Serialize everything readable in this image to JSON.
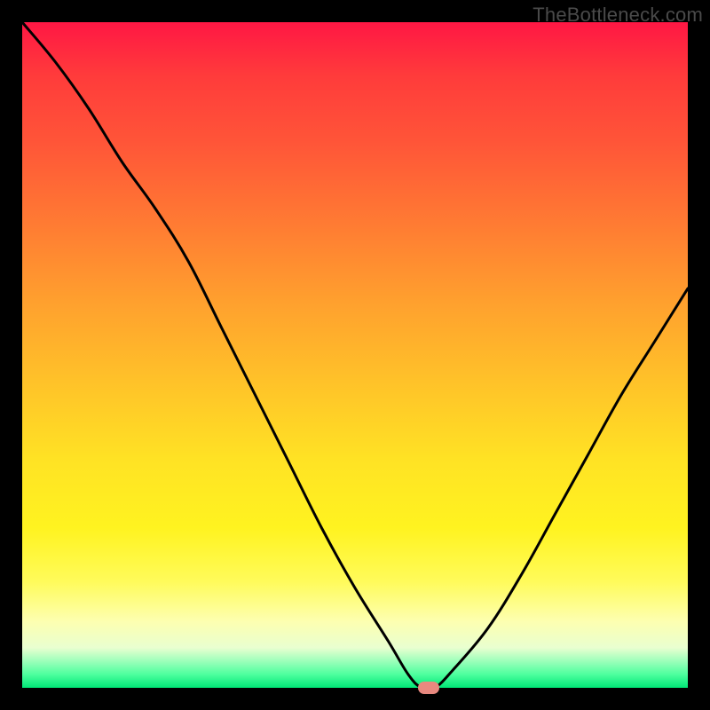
{
  "watermark": "TheBottleneck.com",
  "chart_data": {
    "type": "line",
    "title": "",
    "xlabel": "",
    "ylabel": "",
    "xlim": [
      0,
      100
    ],
    "ylim": [
      0,
      100
    ],
    "grid": false,
    "series": [
      {
        "name": "bottleneck-curve",
        "x": [
          0,
          5,
          10,
          15,
          20,
          25,
          30,
          35,
          40,
          45,
          50,
          55,
          58,
          60,
          62,
          65,
          70,
          75,
          80,
          85,
          90,
          95,
          100
        ],
        "y": [
          100,
          94,
          87,
          79,
          72,
          64,
          54,
          44,
          34,
          24,
          15,
          7,
          2,
          0,
          0,
          3,
          9,
          17,
          26,
          35,
          44,
          52,
          60
        ]
      }
    ],
    "marker": {
      "x": 61,
      "y": 0,
      "color": "#e8887f"
    },
    "gradient_stops": [
      {
        "pos": 0,
        "color": "#ff1744"
      },
      {
        "pos": 50,
        "color": "#ffe324"
      },
      {
        "pos": 90,
        "color": "#fdffb0"
      },
      {
        "pos": 100,
        "color": "#00e676"
      }
    ]
  }
}
